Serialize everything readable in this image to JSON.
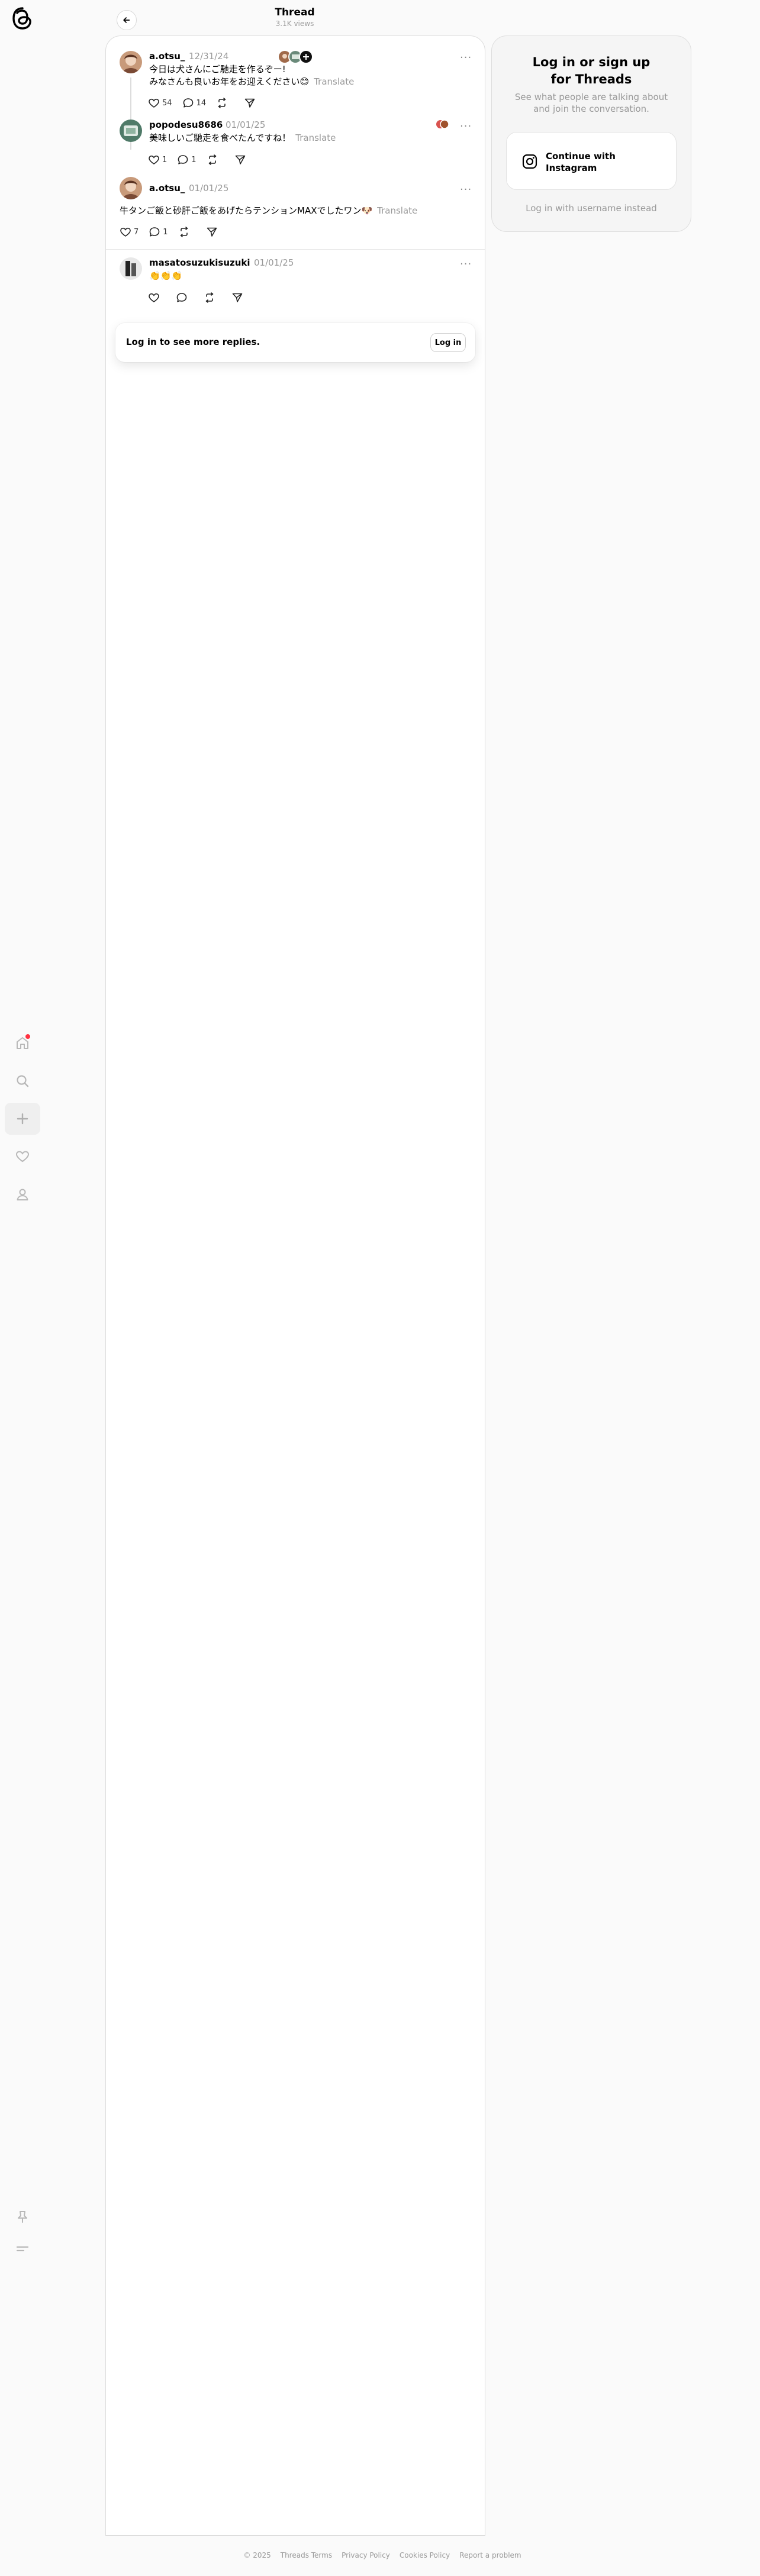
{
  "header": {
    "title": "Thread",
    "views": "3.1K views"
  },
  "nav": {
    "icons": [
      "threads-logo-icon",
      "home-icon",
      "search-icon",
      "plus-icon",
      "heart-icon",
      "profile-icon",
      "pin-icon",
      "menu-icon"
    ]
  },
  "posts": [
    {
      "username": "a.otsu_",
      "date": "12/31/24",
      "text_line1": "今日は犬さんにご馳走を作るぞー!",
      "text_line2": "みなさんも良いお年をお迎えください😊",
      "translate": "Translate",
      "likes": "54",
      "replies": "14",
      "reposts": "",
      "shares": ""
    },
    {
      "username": "popodesu8686",
      "date": "01/01/25",
      "text": "美味しいご馳走を食べたんですね！",
      "translate": "Translate",
      "likes": "1",
      "replies": "1",
      "reposts": "",
      "shares": ""
    },
    {
      "username": "a.otsu_",
      "date": "01/01/25",
      "text": "牛タンご飯と砂肝ご飯をあげたらテンションMAXでしたワン🐶",
      "translate": "Translate",
      "likes": "7",
      "replies": "1",
      "reposts": "",
      "shares": ""
    },
    {
      "username": "masatosuzukisuzuki",
      "date": "01/01/25",
      "text": "👏👏👏",
      "likes": "",
      "replies": "",
      "reposts": "",
      "shares": ""
    }
  ],
  "login_card": {
    "message": "Log in to see more replies.",
    "button": "Log in"
  },
  "signup": {
    "title_line1": "Log in or sign up",
    "title_line2": "for Threads",
    "subtitle": "See what people are talking about and join the conversation.",
    "instagram_line1": "Continue with",
    "instagram_line2": "Instagram",
    "alt_login": "Log in with username instead"
  },
  "footer": {
    "copyright": "© 2025",
    "terms": "Threads Terms",
    "privacy": "Privacy Policy",
    "cookies": "Cookies Policy",
    "report": "Report a problem"
  },
  "colors": {
    "notification_dot": "#ff3040",
    "secondary_text": "#999999",
    "background": "#fafafa"
  }
}
